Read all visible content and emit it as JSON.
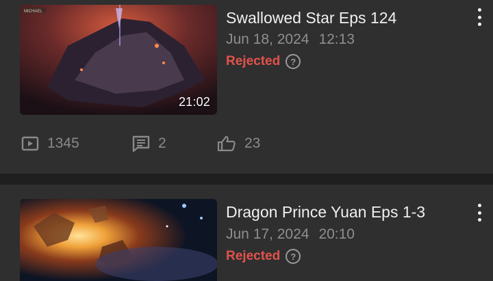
{
  "items": [
    {
      "title": "Swallowed Star Eps 124",
      "date": "Jun 18, 2024",
      "time": "12:13",
      "status": "Rejected",
      "duration": "21:02",
      "stats": {
        "views": "1345",
        "comments": "2",
        "likes": "23"
      },
      "thumb_badge": "MICHAEL"
    },
    {
      "title": "Dragon Prince Yuan Eps 1-3",
      "date": "Jun 17, 2024",
      "time": "20:10",
      "status": "Rejected"
    }
  ],
  "colors": {
    "rejected": "#e3524c",
    "background": "#2f2f2f",
    "divider": "#1f1f1f"
  }
}
